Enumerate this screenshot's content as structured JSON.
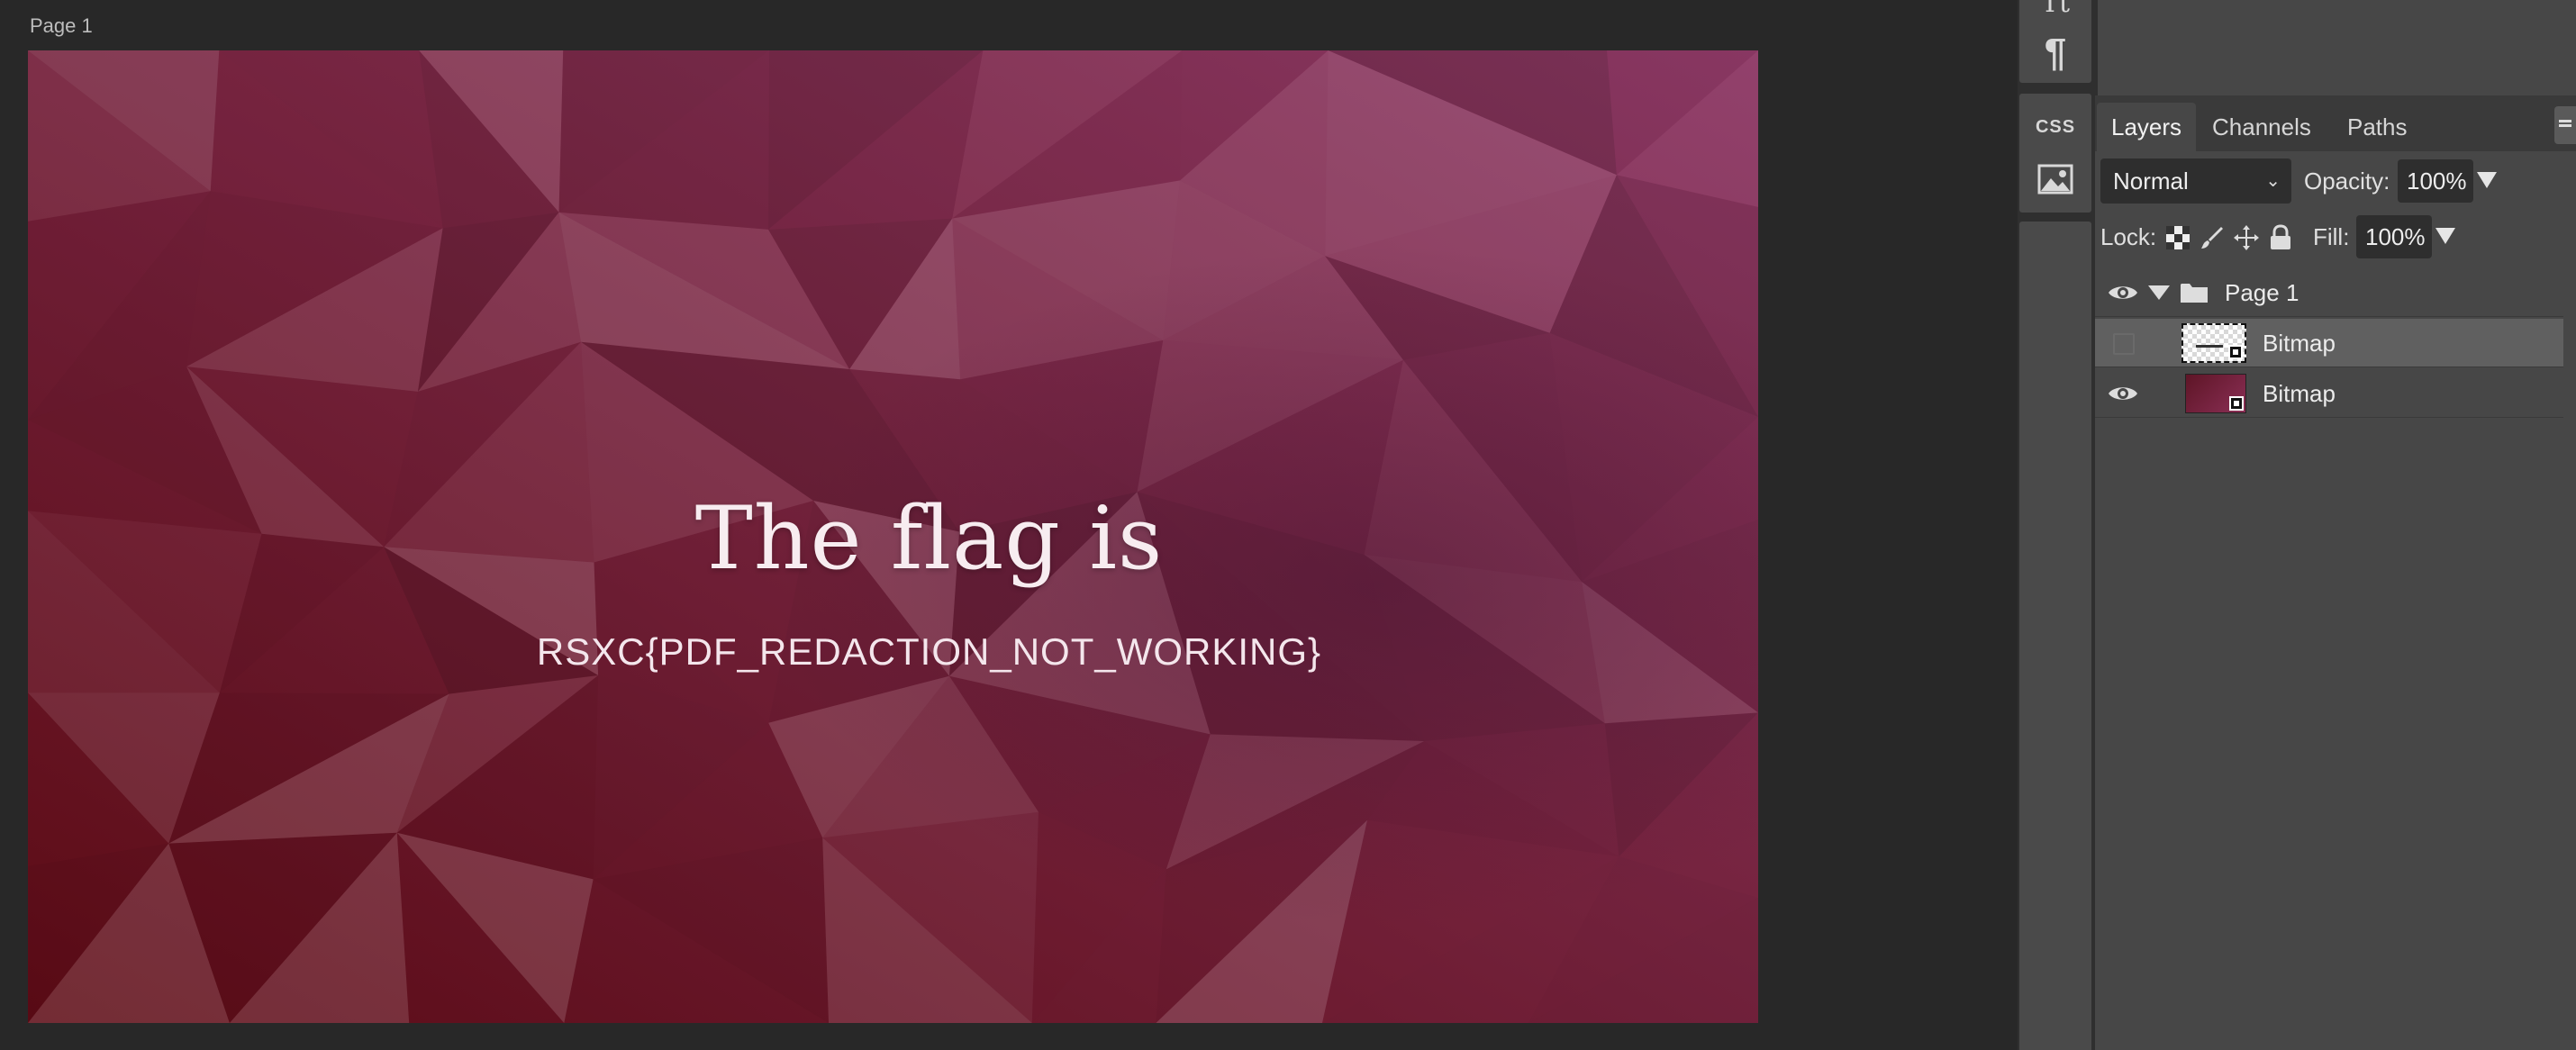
{
  "workspace": {
    "page_label": "Page 1",
    "canvas": {
      "heading": "The flag is",
      "flag_text": "RSXC{PDF_REDACTION_NOT_WORKING}"
    }
  },
  "toolstrip": {
    "text_tool_glyph": "Tt",
    "paragraph_glyph": "¶",
    "css_label": "CSS"
  },
  "panel": {
    "tabs": [
      "Layers",
      "Channels",
      "Paths"
    ],
    "active_tab": "Layers",
    "blend_mode": "Normal",
    "opacity_label": "Opacity:",
    "opacity_value": "100%",
    "lock_label": "Lock:",
    "fill_label": "Fill:",
    "fill_value": "100%",
    "layers": [
      {
        "name": "Page 1",
        "type": "folder",
        "visible": true,
        "expanded": true
      },
      {
        "name": "Bitmap",
        "type": "bitmap",
        "visible": false,
        "selected": true
      },
      {
        "name": "Bitmap",
        "type": "bitmap",
        "visible": true,
        "selected": false
      }
    ]
  },
  "colors": {
    "canvas_accent": "#7c2547",
    "workspace_bg": "#282828",
    "panel_bg": "#474747",
    "selected_row": "#606060"
  }
}
